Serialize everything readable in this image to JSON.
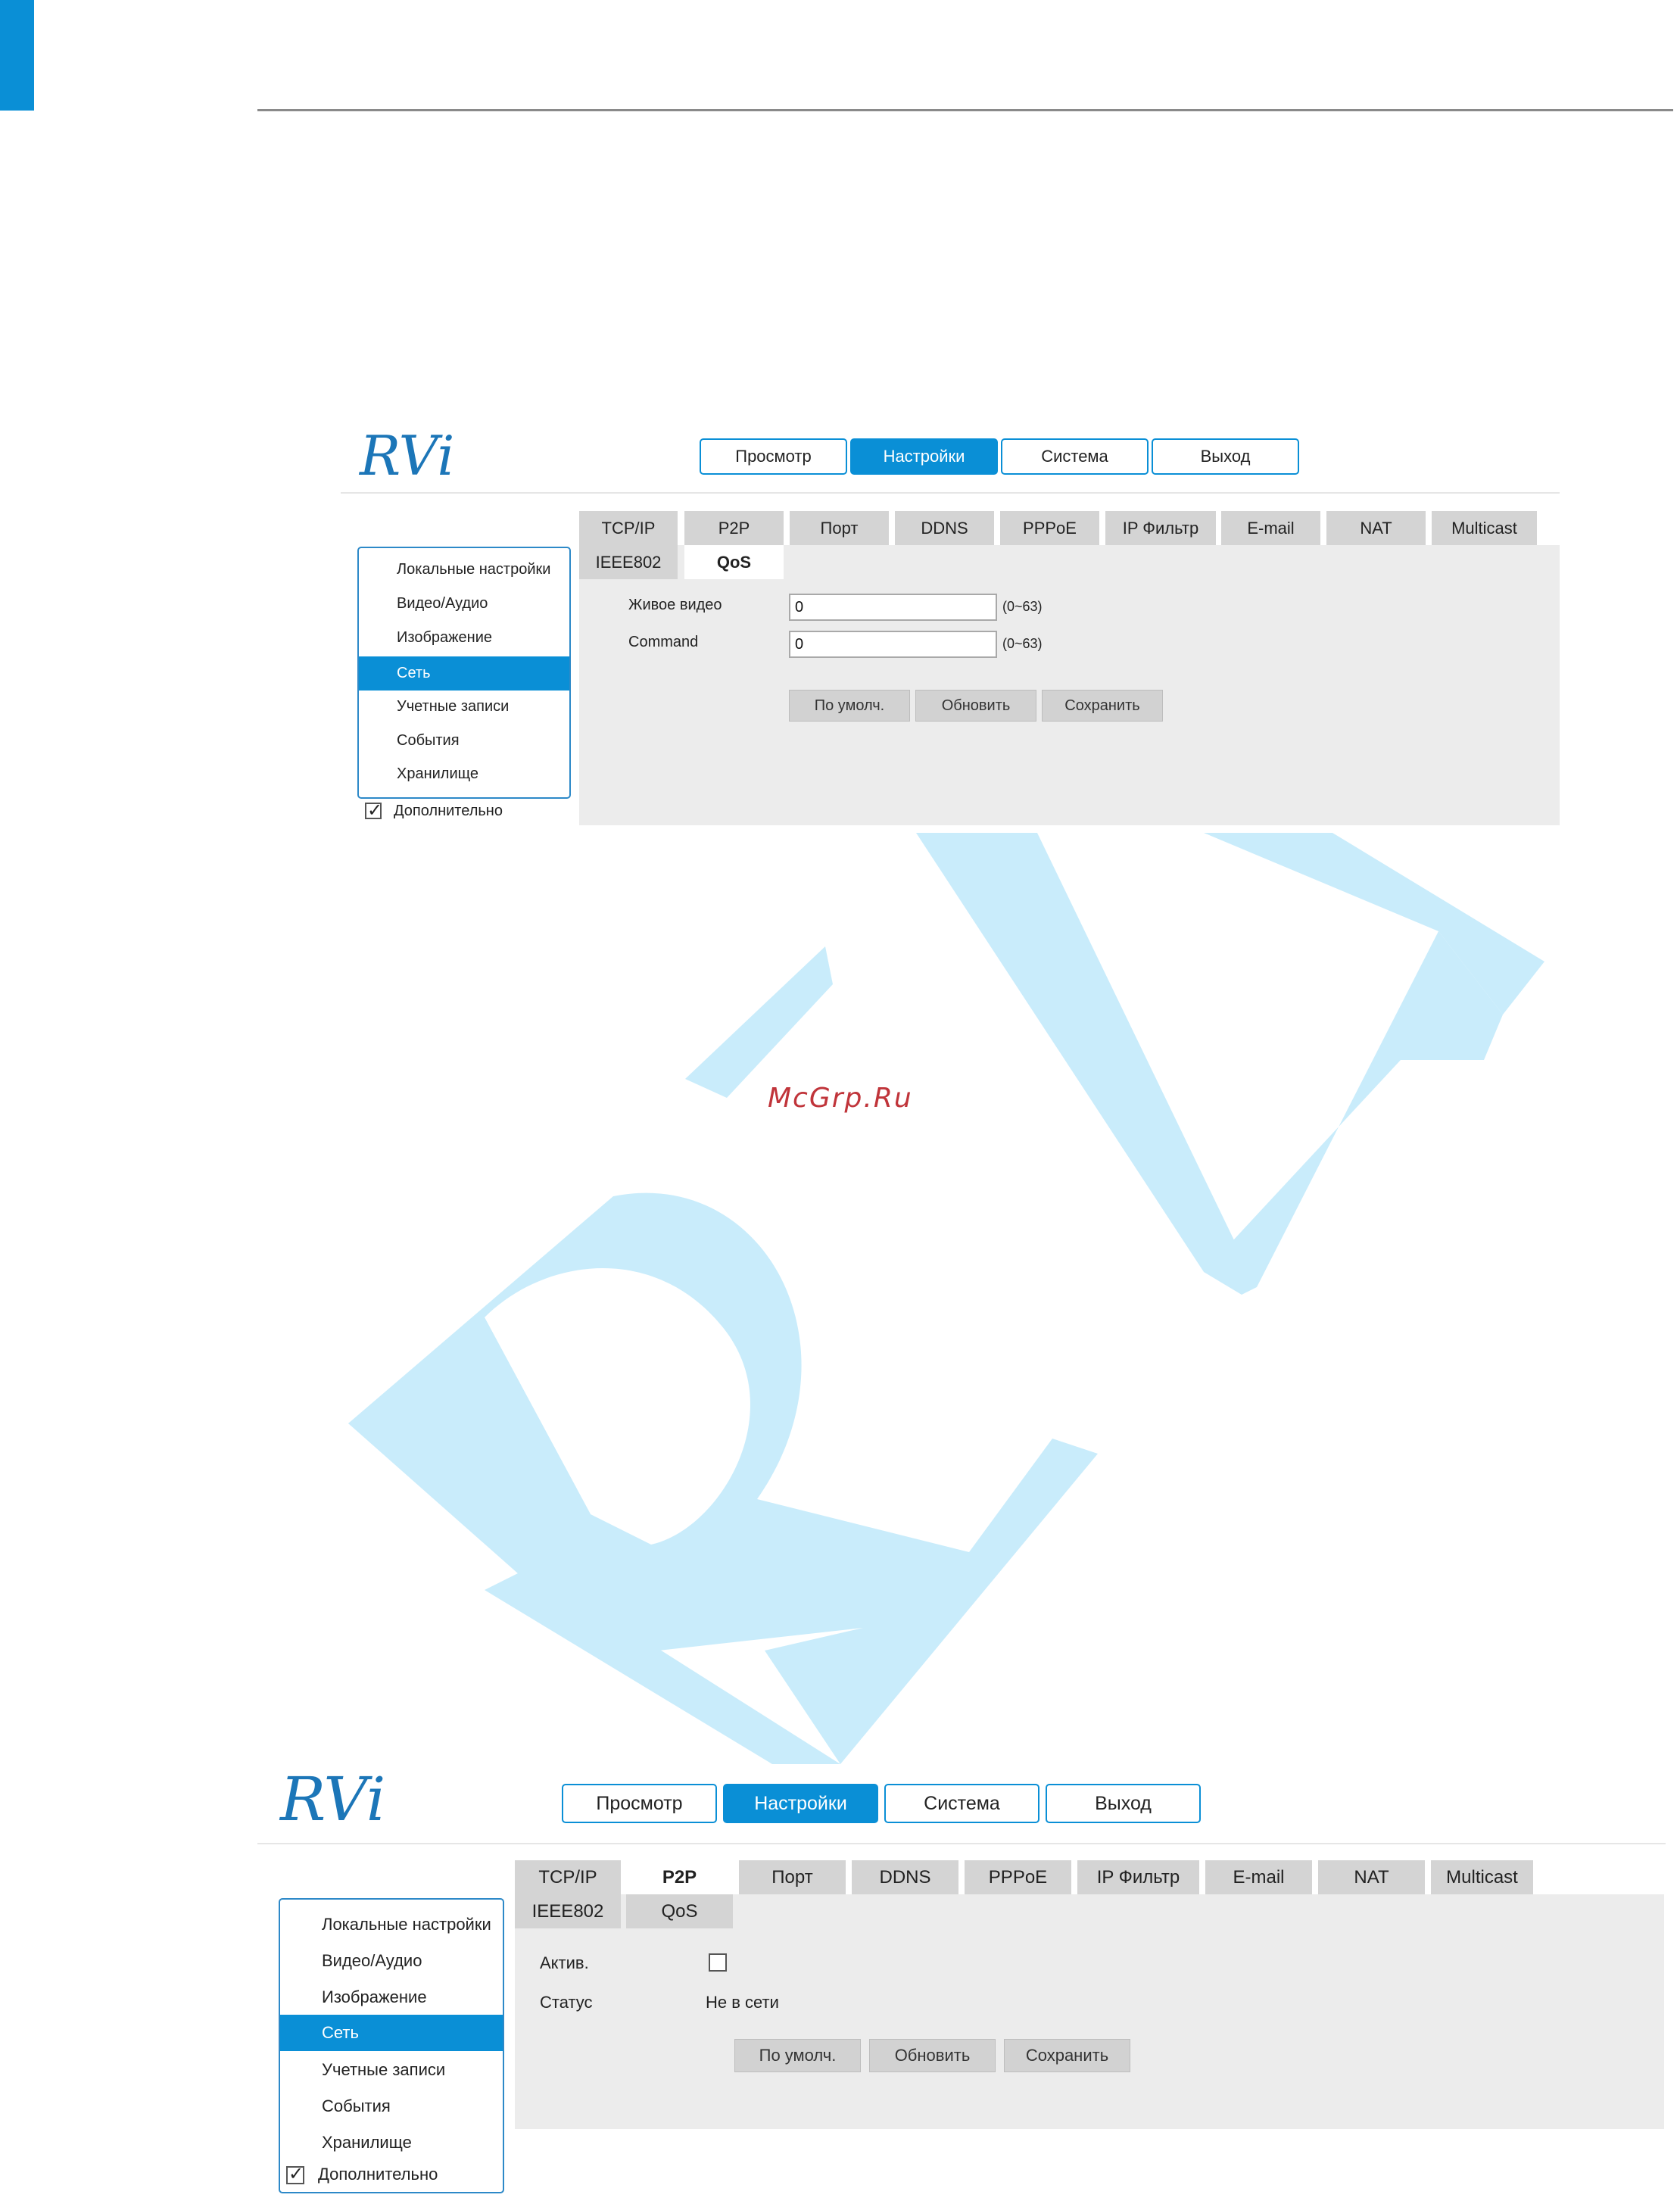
{
  "watermark_site": "McGrp.Ru",
  "colors": {
    "accent": "#0a8fd6",
    "tab_bg": "#d4d4d4",
    "content_bg": "#ececec",
    "watermark": "#c9ecfb"
  },
  "panel1": {
    "logo": "RVi",
    "nav": [
      "Просмотр",
      "Настройки",
      "Система",
      "Выход"
    ],
    "nav_active": "Настройки",
    "tabs_row1": [
      "TCP/IP",
      "P2P",
      "Порт",
      "DDNS",
      "PPPoE",
      "IP Фильтр",
      "E-mail",
      "NAT",
      "Multicast"
    ],
    "tabs_row2": [
      "IEEE802",
      "QoS"
    ],
    "selected_tab": "QoS",
    "sidebar": [
      "Локальные настройки",
      "Видео/Аудио",
      "Изображение",
      "Сеть",
      "Учетные записи",
      "События",
      "Хранилище"
    ],
    "sidebar_active": "Сеть",
    "advanced_label": "Дополнительно",
    "advanced_checked": true,
    "fields": [
      {
        "label": "Живое видео",
        "value": "0",
        "range": "(0~63)"
      },
      {
        "label": "Command",
        "value": "0",
        "range": "(0~63)"
      }
    ],
    "buttons": [
      "По умолч.",
      "Обновить",
      "Сохранить"
    ]
  },
  "panel2": {
    "logo": "RVi",
    "nav": [
      "Просмотр",
      "Настройки",
      "Система",
      "Выход"
    ],
    "nav_active": "Настройки",
    "tabs_row1": [
      "TCP/IP",
      "P2P",
      "Порт",
      "DDNS",
      "PPPoE",
      "IP Фильтр",
      "E-mail",
      "NAT",
      "Multicast"
    ],
    "tabs_row2": [
      "IEEE802",
      "QoS"
    ],
    "selected_tab": "P2P",
    "sidebar": [
      "Локальные настройки",
      "Видео/Аудио",
      "Изображение",
      "Сеть",
      "Учетные записи",
      "События",
      "Хранилище"
    ],
    "sidebar_active": "Сеть",
    "advanced_label": "Дополнительно",
    "advanced_checked": true,
    "enable_label": "Актив.",
    "enable_checked": false,
    "status_label": "Статус",
    "status_value": "Не в сети",
    "buttons": [
      "По умолч.",
      "Обновить",
      "Сохранить"
    ]
  }
}
